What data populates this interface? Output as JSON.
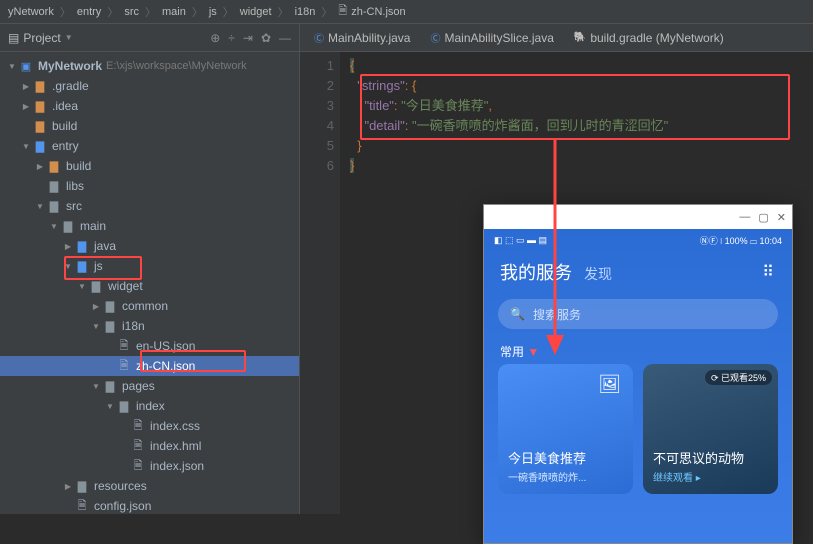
{
  "breadcrumb": [
    "yNetwork",
    "entry",
    "src",
    "main",
    "js",
    "widget",
    "i18n",
    "zh-CN.json"
  ],
  "sidebar": {
    "title": "Project",
    "root": {
      "label": "MyNetwork",
      "path": "E:\\xjs\\workspace\\MyNetwork"
    },
    "items": [
      {
        "label": ".gradle",
        "indent": 1,
        "arrow": "closed",
        "folder": "orange"
      },
      {
        "label": ".idea",
        "indent": 1,
        "arrow": "closed",
        "folder": "orange"
      },
      {
        "label": "build",
        "indent": 1,
        "arrow": "none",
        "folder": "orange"
      },
      {
        "label": "entry",
        "indent": 1,
        "arrow": "open",
        "folder": "blue"
      },
      {
        "label": "build",
        "indent": 2,
        "arrow": "closed",
        "folder": "orange"
      },
      {
        "label": "libs",
        "indent": 2,
        "arrow": "none",
        "folder": ""
      },
      {
        "label": "src",
        "indent": 2,
        "arrow": "open",
        "folder": ""
      },
      {
        "label": "main",
        "indent": 3,
        "arrow": "open",
        "folder": ""
      },
      {
        "label": "java",
        "indent": 4,
        "arrow": "closed",
        "folder": "blue"
      },
      {
        "label": "js",
        "indent": 4,
        "arrow": "open",
        "folder": "blue"
      },
      {
        "label": "widget",
        "indent": 5,
        "arrow": "open",
        "folder": ""
      },
      {
        "label": "common",
        "indent": 6,
        "arrow": "closed",
        "folder": ""
      },
      {
        "label": "i18n",
        "indent": 6,
        "arrow": "open",
        "folder": ""
      },
      {
        "label": "en-US.json",
        "indent": 7,
        "arrow": "none",
        "file": true
      },
      {
        "label": "zh-CN.json",
        "indent": 7,
        "arrow": "none",
        "file": true,
        "selected": true
      },
      {
        "label": "pages",
        "indent": 6,
        "arrow": "open",
        "folder": ""
      },
      {
        "label": "index",
        "indent": 7,
        "arrow": "open",
        "folder": ""
      },
      {
        "label": "index.css",
        "indent": 8,
        "arrow": "none",
        "file": true
      },
      {
        "label": "index.hml",
        "indent": 8,
        "arrow": "none",
        "file": true
      },
      {
        "label": "index.json",
        "indent": 8,
        "arrow": "none",
        "file": true
      },
      {
        "label": "resources",
        "indent": 4,
        "arrow": "closed",
        "folder": ""
      },
      {
        "label": "config.json",
        "indent": 4,
        "arrow": "none",
        "file": true
      }
    ]
  },
  "tabs": [
    {
      "label": "MainAbility.java",
      "type": "java"
    },
    {
      "label": "MainAbilitySlice.java",
      "type": "java"
    },
    {
      "label": "build.gradle (MyNetwork)",
      "type": "gradle"
    }
  ],
  "code": {
    "lines": [
      "1",
      "2",
      "3",
      "4",
      "5",
      "6"
    ],
    "strings_key": "\"strings\"",
    "title_key": "\"title\"",
    "title_val": "\"今日美食推荐\"",
    "detail_key": "\"detail\"",
    "detail_val": "\"一碗香喷喷的炸酱面，回到儿时的青涩回忆\""
  },
  "phone": {
    "status_left": "◧ ⬚ ▭ ▬ ▤",
    "status_right": "ⓃⒻ ⧘ 100% ▭ 10:04",
    "title": "我的服务",
    "subtitle": "发现",
    "menu": "⠿",
    "search_placeholder": "搜索服务",
    "section": "常用",
    "arrow": "▼",
    "card1": {
      "title": "今日美食推荐",
      "sub": "一碗香喷喷的炸..."
    },
    "card2": {
      "badge": "⟳ 已观看25%",
      "title": "不可思议的动物",
      "link": "继续观看 ▸"
    }
  }
}
